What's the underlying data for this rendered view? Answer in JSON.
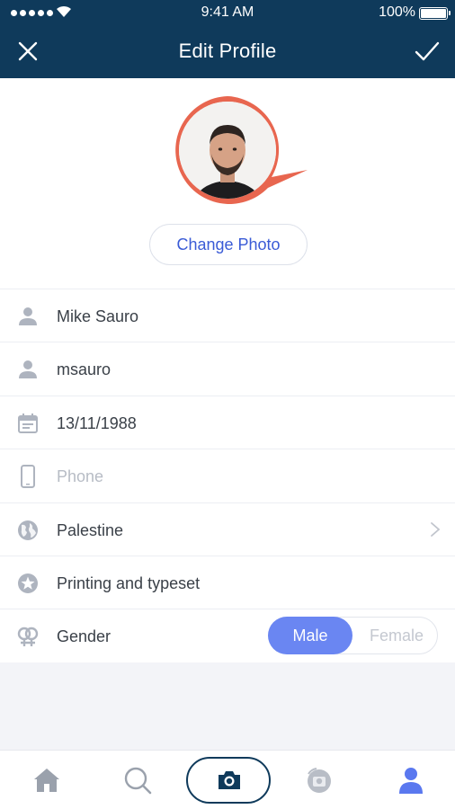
{
  "status_bar": {
    "time": "9:41 AM",
    "battery": "100%"
  },
  "header": {
    "title": "Edit Profile"
  },
  "profile": {
    "change_photo_label": "Change Photo"
  },
  "fields": [
    {
      "icon": "person-icon",
      "value": "Mike Sauro",
      "placeholder": false
    },
    {
      "icon": "person-icon",
      "value": "msauro",
      "placeholder": false
    },
    {
      "icon": "calendar-icon",
      "value": "13/11/1988",
      "placeholder": false
    },
    {
      "icon": "phone-icon",
      "value": "Phone",
      "placeholder": true
    },
    {
      "icon": "globe-icon",
      "value": "Palestine",
      "placeholder": false
    },
    {
      "icon": "star-icon",
      "value": "Printing and typeset",
      "placeholder": false
    },
    {
      "icon": "gender-icon",
      "value": "Gender",
      "placeholder": false
    }
  ],
  "gender": {
    "options": [
      "Male",
      "Female"
    ],
    "selected": "Male"
  },
  "tab_bar": {
    "tabs": [
      "home-icon",
      "search-icon",
      "camera-icon",
      "camera-rotate-icon",
      "profile-icon"
    ],
    "active": "profile-icon"
  },
  "colors": {
    "header_bg": "#0f3a5b",
    "accent": "#6a86f2",
    "link": "#3a5bd6",
    "avatar_ring": "#e8664f"
  }
}
